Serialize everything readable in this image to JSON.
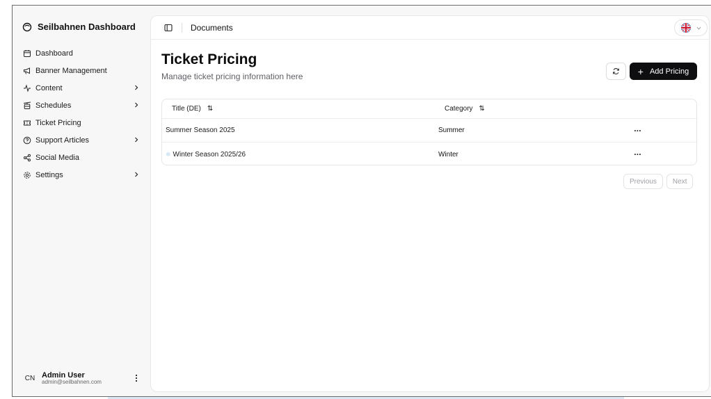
{
  "app": {
    "title": "Seilbahnen Dashboard"
  },
  "sidebar": {
    "items": [
      {
        "label": "Dashboard",
        "icon": "calendar-icon",
        "has_submenu": false
      },
      {
        "label": "Banner Management",
        "icon": "megaphone-icon",
        "has_submenu": false
      },
      {
        "label": "Content",
        "icon": "activity-icon",
        "has_submenu": true
      },
      {
        "label": "Schedules",
        "icon": "cable-car-icon",
        "has_submenu": true
      },
      {
        "label": "Ticket Pricing",
        "icon": "ticket-icon",
        "has_submenu": false
      },
      {
        "label": "Support Articles",
        "icon": "help-circle-icon",
        "has_submenu": true
      },
      {
        "label": "Social Media",
        "icon": "share-icon",
        "has_submenu": false
      },
      {
        "label": "Settings",
        "icon": "gear-icon",
        "has_submenu": true
      }
    ]
  },
  "user": {
    "initials": "CN",
    "name": "Admin User",
    "email": "admin@seilbahnen.com"
  },
  "header": {
    "breadcrumb": "Documents",
    "language_flag": "uk-flag-icon"
  },
  "page": {
    "title": "Ticket Pricing",
    "subtitle": "Manage ticket pricing information here",
    "add_button_label": "Add Pricing",
    "add_button_icon": "+"
  },
  "table": {
    "columns": [
      {
        "label": "Title (DE)",
        "sort_icon": "⇅"
      },
      {
        "label": "Category",
        "sort_icon": "⇅"
      }
    ],
    "rows": [
      {
        "title": "Summer Season 2025",
        "category": "Summer",
        "actions": "···"
      },
      {
        "title": "Winter Season 2025/26",
        "category": "Winter",
        "actions": "···",
        "title_icon": "❄"
      }
    ]
  },
  "pagination": {
    "previous": "Previous",
    "next": "Next"
  },
  "colors": {
    "primary_button": "#0e0e10",
    "sidebar_bg": "#f7f7f8",
    "panel_bg": "#ffffff"
  }
}
